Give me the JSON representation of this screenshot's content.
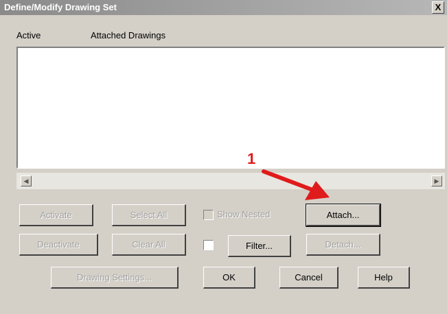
{
  "window": {
    "title": "Define/Modify Drawing Set",
    "close_glyph": "X"
  },
  "list": {
    "columns": [
      "Active",
      "Attached Drawings"
    ],
    "rows": []
  },
  "buttons": {
    "activate": "Activate",
    "select_all": "Select All",
    "attach": "Attach...",
    "deactivate": "Deactivate",
    "clear_all": "Clear All",
    "filter": "Filter...",
    "detach": "Detach...",
    "drawing_settings": "Drawing Settings...",
    "ok": "OK",
    "cancel": "Cancel",
    "help": "Help"
  },
  "checkboxes": {
    "show_nested": {
      "label": "Show Nested",
      "checked": false,
      "enabled": false
    },
    "filter_toggle": {
      "checked": false,
      "enabled": true
    }
  },
  "annotation": {
    "label": "1",
    "color": "#e01b1b"
  }
}
